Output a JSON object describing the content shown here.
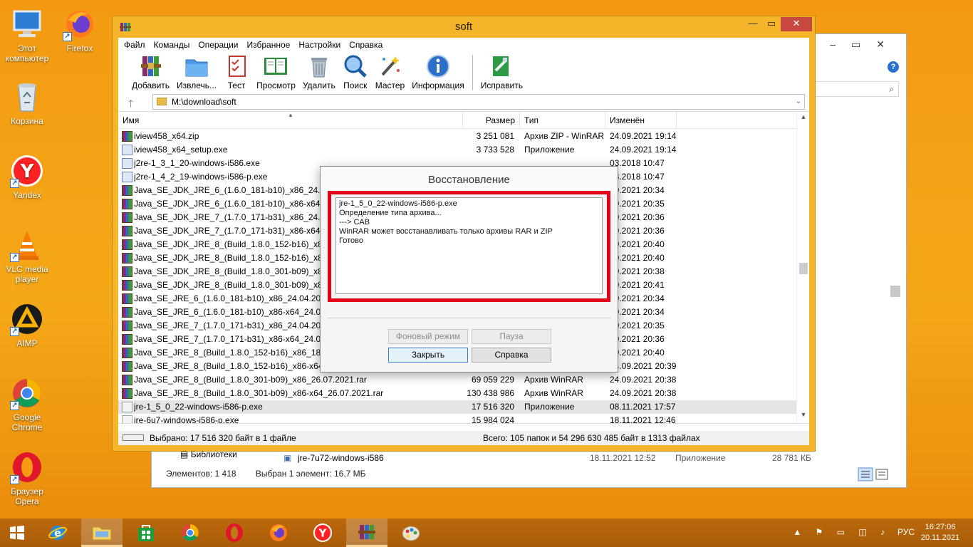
{
  "desktop": {
    "icons": [
      {
        "label": "Этот компьютер",
        "icon": "computer-icon"
      },
      {
        "label": "Firefox",
        "icon": "firefox-icon"
      },
      {
        "label": "Корзина",
        "icon": "recycle-bin-icon"
      },
      {
        "label": "Yandex",
        "icon": "yandex-icon"
      },
      {
        "label": "VLC media player",
        "icon": "vlc-icon"
      },
      {
        "label": "AIMP",
        "icon": "aimp-icon"
      },
      {
        "label": "Google Chrome",
        "icon": "chrome-icon"
      },
      {
        "label": "Браузер Opera",
        "icon": "opera-icon"
      }
    ]
  },
  "explorer": {
    "library_label": "Библиотеки",
    "row": {
      "name": "jre-7u72-windows-i586",
      "date": "18.11.2021 12:52",
      "type": "Приложение",
      "size": "28 781 КБ"
    },
    "status_items": "Элементов: 1 418",
    "status_selected": "Выбран 1 элемент: 16,7 МБ",
    "help_glyph": "?"
  },
  "winrar": {
    "title": "soft",
    "menu": [
      "Файл",
      "Команды",
      "Операции",
      "Избранное",
      "Настройки",
      "Справка"
    ],
    "toolbar": [
      {
        "label": "Добавить",
        "icon": "add-archive-icon"
      },
      {
        "label": "Извлечь...",
        "icon": "extract-icon"
      },
      {
        "label": "Тест",
        "icon": "test-icon"
      },
      {
        "label": "Просмотр",
        "icon": "view-book-icon"
      },
      {
        "label": "Удалить",
        "icon": "trash-icon"
      },
      {
        "label": "Поиск",
        "icon": "magnifier-icon"
      },
      {
        "label": "Мастер",
        "icon": "wizard-icon"
      },
      {
        "label": "Информация",
        "icon": "info-icon"
      },
      {
        "label": "Исправить",
        "icon": "repair-icon"
      }
    ],
    "address": "M:\\download\\soft",
    "columns": {
      "name": "Имя",
      "size": "Размер",
      "type": "Тип",
      "modified": "Изменён"
    },
    "files": [
      {
        "name": "iview458_x64.zip",
        "size": "3 251 081",
        "type": "Архив ZIP - WinRAR",
        "date": "24.09.2021 19:14",
        "icon": "rar"
      },
      {
        "name": "iview458_x64_setup.exe",
        "size": "3 733 528",
        "type": "Приложение",
        "date": "24.09.2021 19:14",
        "icon": "exe"
      },
      {
        "name": "j2re-1_3_1_20-windows-i586.exe",
        "size": "",
        "type": "",
        "date": "03.2018 10:47",
        "icon": "exe"
      },
      {
        "name": "j2re-1_4_2_19-windows-i586-p.exe",
        "size": "",
        "type": "",
        "date": "03.2018 10:47",
        "icon": "exe"
      },
      {
        "name": "Java_SE_JDK_JRE_6_(1.6.0_181-b10)_x86_24.04.2021",
        "size": "",
        "type": "",
        "date": "09.2021 20:34",
        "icon": "rar"
      },
      {
        "name": "Java_SE_JDK_JRE_6_(1.6.0_181-b10)_x86-x64_24.04.2",
        "size": "",
        "type": "",
        "date": "09.2021 20:35",
        "icon": "rar"
      },
      {
        "name": "Java_SE_JDK_JRE_7_(1.7.0_171-b31)_x86_24.04.2021",
        "size": "",
        "type": "",
        "date": "09.2021 20:36",
        "icon": "rar"
      },
      {
        "name": "Java_SE_JDK_JRE_7_(1.7.0_171-b31)_x86-x64_24.04.2",
        "size": "",
        "type": "",
        "date": "09.2021 20:36",
        "icon": "rar"
      },
      {
        "name": "Java_SE_JDK_JRE_8_(Build_1.8.0_152-b16)_x86_18.10",
        "size": "",
        "type": "",
        "date": "09.2021 20:40",
        "icon": "rar"
      },
      {
        "name": "Java_SE_JDK_JRE_8_(Build_1.8.0_152-b16)_x86-x64",
        "size": "",
        "type": "",
        "date": "09.2021 20:40",
        "icon": "rar"
      },
      {
        "name": "Java_SE_JDK_JRE_8_(Build_1.8.0_301-b09)_x86_26.0",
        "size": "",
        "type": "",
        "date": "09.2021 20:38",
        "icon": "rar"
      },
      {
        "name": "Java_SE_JDK_JRE_8_(Build_1.8.0_301-b09)_x86-x64",
        "size": "",
        "type": "",
        "date": "09.2021 20:41",
        "icon": "rar"
      },
      {
        "name": "Java_SE_JRE_6_(1.6.0_181-b10)_x86_24.04.2021.rar",
        "size": "",
        "type": "",
        "date": "09.2021 20:34",
        "icon": "rar"
      },
      {
        "name": "Java_SE_JRE_6_(1.6.0_181-b10)_x86-x64_24.04.2021",
        "size": "",
        "type": "",
        "date": "09.2021 20:34",
        "icon": "rar"
      },
      {
        "name": "Java_SE_JRE_7_(1.7.0_171-b31)_x86_24.04.2021.rar",
        "size": "",
        "type": "",
        "date": "09.2021 20:35",
        "icon": "rar"
      },
      {
        "name": "Java_SE_JRE_7_(1.7.0_171-b31)_x86-x64_24.04.2021",
        "size": "",
        "type": "",
        "date": "09.2021 20:36",
        "icon": "rar"
      },
      {
        "name": "Java_SE_JRE_8_(Build_1.8.0_152-b16)_x86_18.10.201",
        "size": "",
        "type": "",
        "date": "09.2021 20:40",
        "icon": "rar"
      },
      {
        "name": "Java_SE_JRE_8_(Build_1.8.0_152-b16)_x86-x64_18.10.2017.rar",
        "size": "100 898 708",
        "type": "Архив WinRAR",
        "date": "24.09.2021 20:39",
        "icon": "rar"
      },
      {
        "name": "Java_SE_JRE_8_(Build_1.8.0_301-b09)_x86_26.07.2021.rar",
        "size": "69 059 229",
        "type": "Архив WinRAR",
        "date": "24.09.2021 20:38",
        "icon": "rar"
      },
      {
        "name": "Java_SE_JRE_8_(Build_1.8.0_301-b09)_x86-x64_26.07.2021.rar",
        "size": "130 438 986",
        "type": "Архив WinRAR",
        "date": "24.09.2021 20:38",
        "icon": "rar"
      },
      {
        "name": "jre-1_5_0_22-windows-i586-p.exe",
        "size": "17 516 320",
        "type": "Приложение",
        "date": "08.11.2021 17:57",
        "icon": "java",
        "selected": true
      },
      {
        "name": "jre-6u7-windows-i586-p.exe",
        "size": "15 984 024",
        "type": "",
        "date": "18.11.2021 12:46",
        "icon": "java"
      }
    ],
    "status_left": "Выбрано: 17 516 320 байт в 1 файле",
    "status_right": "Всего: 105 папок и 54 296 630 485 байт в 1313 файлах"
  },
  "dialog": {
    "title": "Восстановление",
    "log": [
      "jre-1_5_0_22-windows-i586-p.exe",
      "Определение типа архива...",
      "---> CAB",
      "WinRAR может восстанавливать только архивы RAR и ZIP",
      "Готово"
    ],
    "buttons": {
      "background": "Фоновый режим",
      "pause": "Пауза",
      "close": "Закрыть",
      "help": "Справка"
    },
    "highlight_color": "#e3001b"
  },
  "taskbar": {
    "items": [
      {
        "name": "start-button",
        "icon": "windows-logo-icon"
      },
      {
        "name": "internet-explorer",
        "icon": "internet-explorer-icon"
      },
      {
        "name": "file-explorer",
        "icon": "file-explorer-icon"
      },
      {
        "name": "store",
        "icon": "store-icon"
      },
      {
        "name": "chrome",
        "icon": "chrome-icon"
      },
      {
        "name": "opera",
        "icon": "opera-icon"
      },
      {
        "name": "firefox",
        "icon": "firefox-icon"
      },
      {
        "name": "yandex",
        "icon": "yandex-icon"
      },
      {
        "name": "winrar",
        "icon": "winrar-icon"
      },
      {
        "name": "paint",
        "icon": "paint-icon"
      }
    ],
    "tray_glyphs": "▲ ⚑ ▭ ◫ ♪",
    "language": "РУС",
    "time": "16:27:06",
    "date": "20.11.2021"
  }
}
